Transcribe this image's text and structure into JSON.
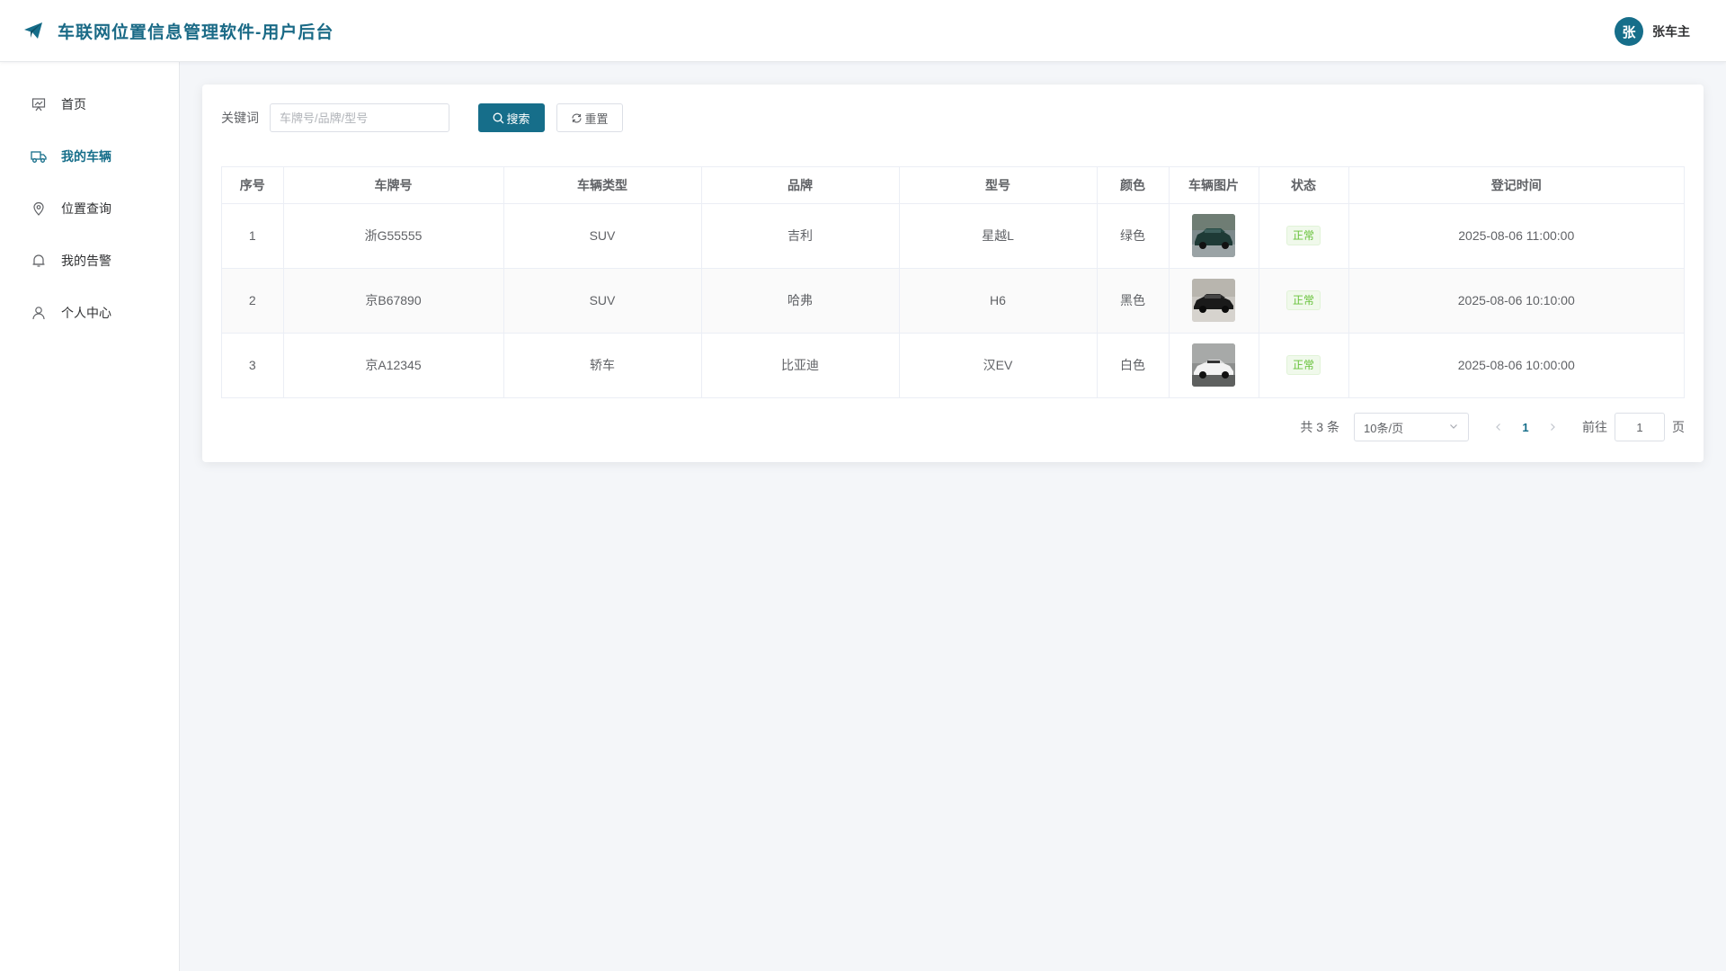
{
  "header": {
    "title": "车联网位置信息管理软件-用户后台",
    "logo_icon": "paper-plane-icon",
    "user": {
      "avatar_text": "张",
      "name": "张车主"
    },
    "accent_color": "#166e8a"
  },
  "sidebar": {
    "items": [
      {
        "label": "首页",
        "icon": "presentation-icon",
        "active": false
      },
      {
        "label": "我的车辆",
        "icon": "truck-icon",
        "active": true
      },
      {
        "label": "位置查询",
        "icon": "location-pin-icon",
        "active": false
      },
      {
        "label": "我的告警",
        "icon": "bell-icon",
        "active": false
      },
      {
        "label": "个人中心",
        "icon": "user-icon",
        "active": false
      }
    ]
  },
  "search": {
    "label": "关键词",
    "placeholder": "车牌号/品牌/型号",
    "value": "",
    "search_button": "搜索",
    "reset_button": "重置"
  },
  "table": {
    "columns": [
      "序号",
      "车牌号",
      "车辆类型",
      "品牌",
      "型号",
      "颜色",
      "车辆图片",
      "状态",
      "登记时间"
    ],
    "rows": [
      {
        "index": "1",
        "plate": "浙G55555",
        "type": "SUV",
        "brand": "吉利",
        "model": "星越L",
        "color": "绿色",
        "image": "dark-green-suv",
        "status": "正常",
        "time": "2025-08-06 11:00:00"
      },
      {
        "index": "2",
        "plate": "京B67890",
        "type": "SUV",
        "brand": "哈弗",
        "model": "H6",
        "color": "黑色",
        "image": "black-suv",
        "status": "正常",
        "time": "2025-08-06 10:10:00"
      },
      {
        "index": "3",
        "plate": "京A12345",
        "type": "轿车",
        "brand": "比亚迪",
        "model": "汉EV",
        "color": "白色",
        "image": "white-sedan",
        "status": "正常",
        "time": "2025-08-06 10:00:00"
      }
    ]
  },
  "pagination": {
    "total": "共 3 条",
    "page_size": "10条/页",
    "current_page": "1",
    "goto_label": "前往",
    "goto_value": "1",
    "page_suffix": "页"
  }
}
